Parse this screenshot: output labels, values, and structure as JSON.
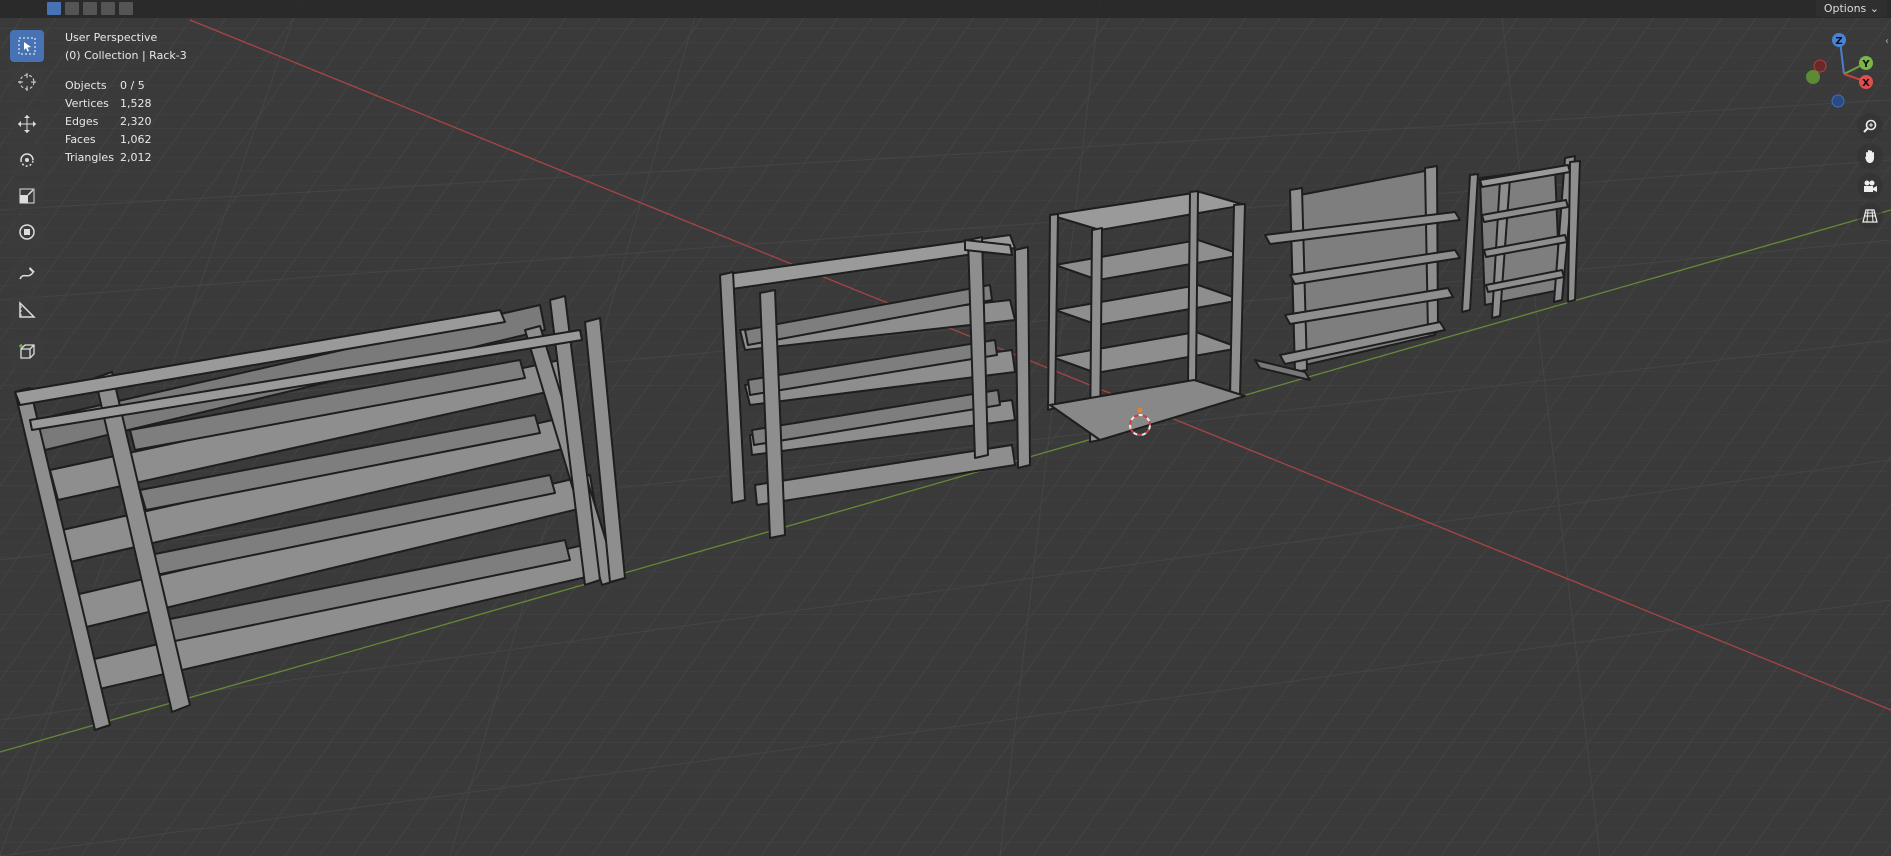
{
  "header": {
    "options_label": "Options"
  },
  "viewport": {
    "view_name": "User Perspective",
    "collection": "(0) Collection | Rack-3"
  },
  "stats": [
    {
      "label": "Objects",
      "value": "0 / 5"
    },
    {
      "label": "Vertices",
      "value": "1,528"
    },
    {
      "label": "Edges",
      "value": "2,320"
    },
    {
      "label": "Faces",
      "value": "1,062"
    },
    {
      "label": "Triangles",
      "value": "2,012"
    }
  ],
  "gizmo": {
    "z_label": "Z",
    "y_label": "Y",
    "x_label": "X"
  },
  "toolbar": {
    "tools": [
      "select-box",
      "cursor",
      "move",
      "rotate",
      "scale",
      "transform",
      "annotate",
      "measure",
      "add-cube"
    ]
  },
  "colors": {
    "background": "#3a3a3a",
    "x_axis": "#b84848",
    "y_axis": "#6e9a3c",
    "active": "#4772b3",
    "object_face": "#8e8e8e"
  }
}
